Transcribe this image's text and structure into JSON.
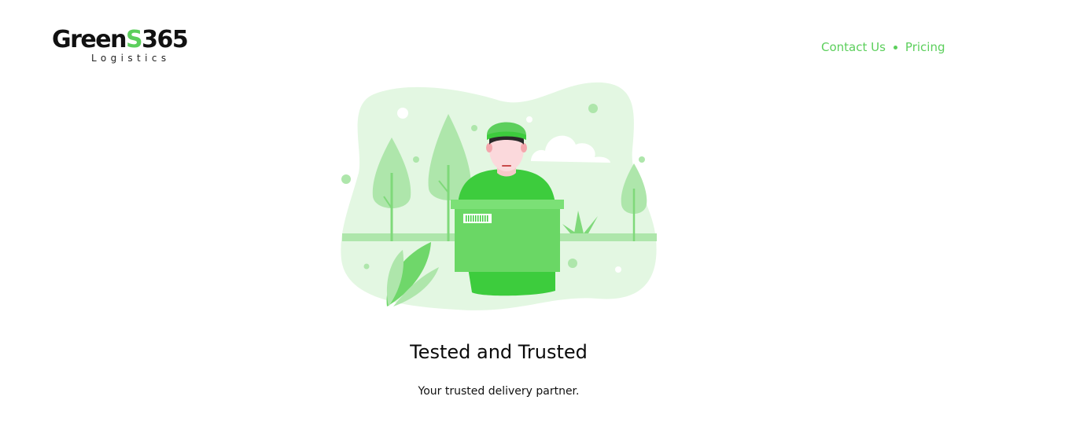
{
  "header": {
    "logo": {
      "brand_prefix": "Green",
      "brand_accent": "S",
      "brand_suffix": "365",
      "subtitle": "Logistics"
    },
    "nav": {
      "items": [
        {
          "label": "Contact Us"
        },
        {
          "label": "Pricing"
        }
      ]
    }
  },
  "hero": {
    "illustration_icon": "delivery-person-with-box-illustration",
    "title": "Tested and Trusted",
    "tagline": "Your trusted delivery partner."
  },
  "colors": {
    "accent": "#5ccf5c",
    "text": "#111111",
    "background": "#ffffff"
  }
}
